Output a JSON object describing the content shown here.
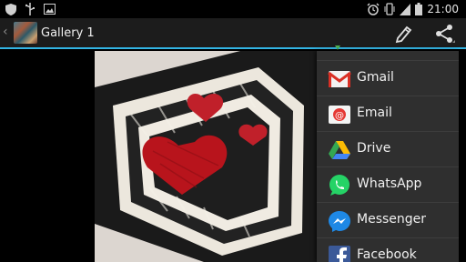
{
  "status_bar": {
    "time": "21:00",
    "left_icons": [
      "shield-icon",
      "usb-icon",
      "image-icon"
    ],
    "right_icons": [
      "alarm-icon",
      "vibrate-icon",
      "signal-icon",
      "battery-icon"
    ]
  },
  "action_bar": {
    "title": "Gallery 1",
    "actions": [
      "edit-icon",
      "share-icon"
    ]
  },
  "share_menu": {
    "items": [
      {
        "label": "Gmail",
        "icon": "gmail-icon"
      },
      {
        "label": "Email",
        "icon": "email-icon"
      },
      {
        "label": "Drive",
        "icon": "drive-icon"
      },
      {
        "label": "WhatsApp",
        "icon": "whatsapp-icon"
      },
      {
        "label": "Messenger",
        "icon": "messenger-icon"
      },
      {
        "label": "Facebook",
        "icon": "facebook-icon"
      }
    ]
  },
  "colors": {
    "accent": "#33b5e5",
    "menu_bg": "#2f2f2f",
    "action_bar_bg": "#1c1c1c"
  }
}
